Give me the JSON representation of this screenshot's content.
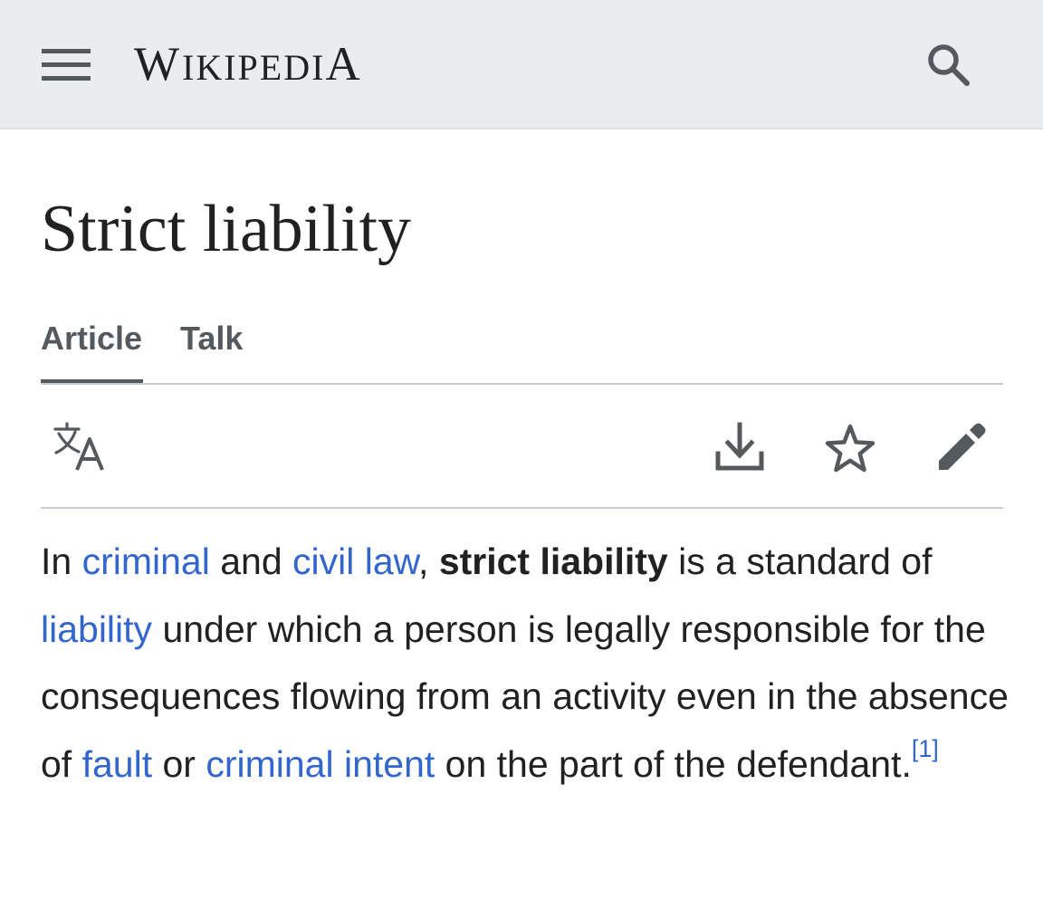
{
  "header": {
    "wordmark": {
      "initial": "W",
      "middle": "IKIPEDI",
      "final": "A"
    },
    "menu_icon": "hamburger-menu-icon",
    "search_icon": "search-icon",
    "background": "#eaecf0"
  },
  "page": {
    "title": "Strict liability"
  },
  "tabs": [
    {
      "label": "Article",
      "selected": true
    },
    {
      "label": "Talk",
      "selected": false
    }
  ],
  "toolbar": {
    "icons": [
      "language-icon",
      "download-icon",
      "star-icon",
      "edit-icon"
    ]
  },
  "article": {
    "p1": {
      "t1": "In ",
      "link_criminal": "criminal",
      "t2": " and ",
      "link_civil_law": "civil law",
      "t3": ", ",
      "bold_term": "strict liability",
      "t4": " is a standard of ",
      "link_liability": "liability",
      "t5": " under which a person is legally responsible for the consequences flowing from an activity even in the absence of ",
      "link_fault": "fault",
      "t6": " or ",
      "link_criminal_intent": "criminal intent",
      "t7": " on the part of the defendant.",
      "ref": "[1]"
    }
  },
  "colors": {
    "link": "#3366cc",
    "text": "#202122",
    "icon": "#54595d",
    "divider": "#c8ccd1"
  }
}
